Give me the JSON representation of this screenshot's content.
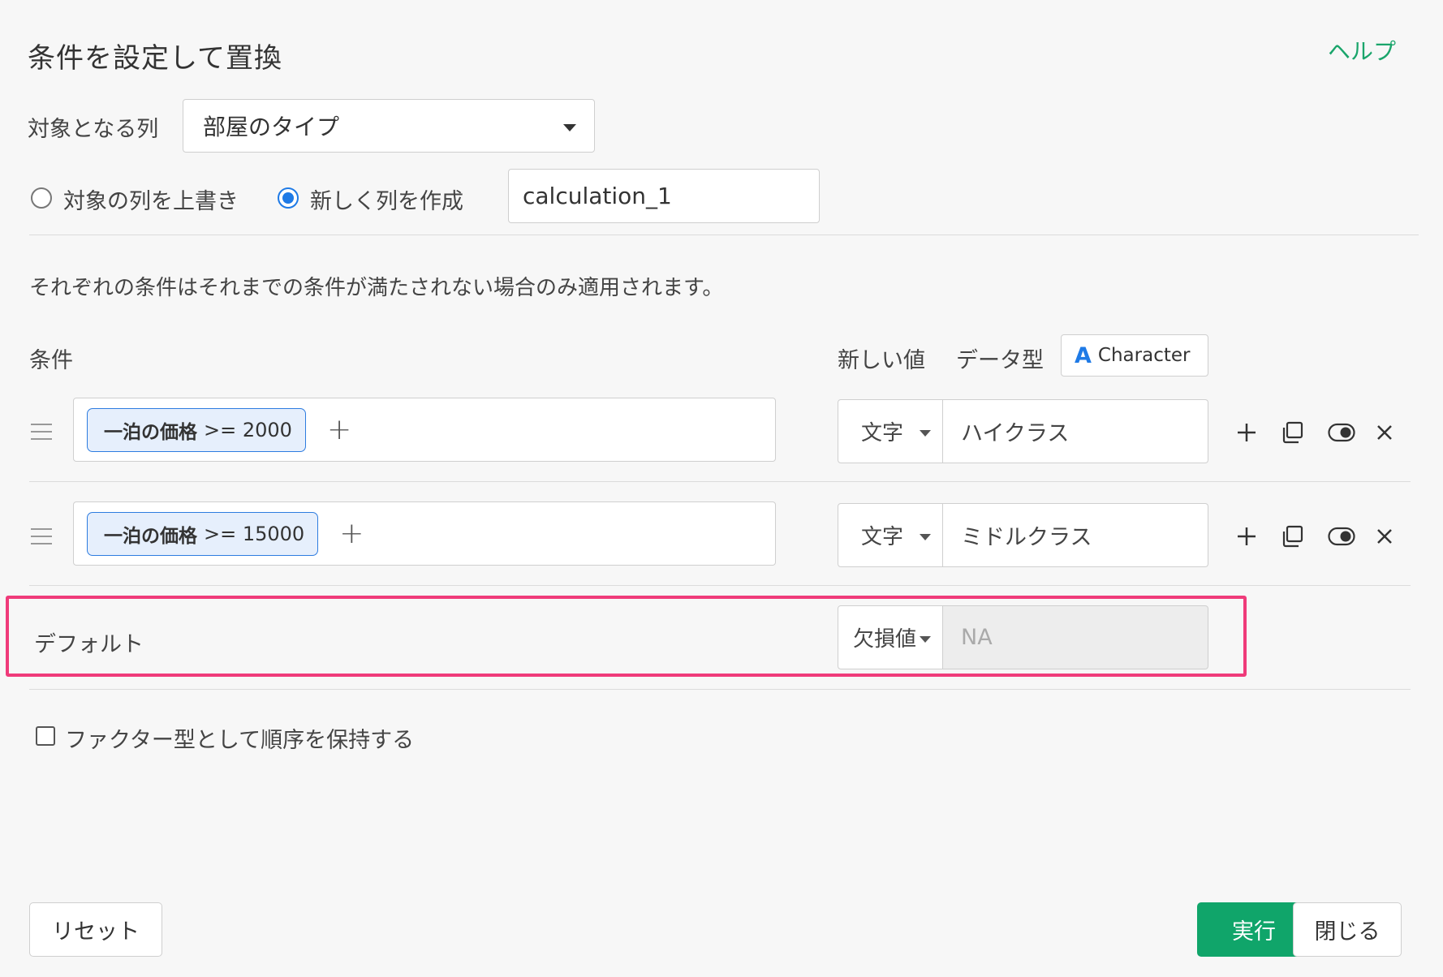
{
  "dialog": {
    "title": "条件を設定して置換",
    "help": "ヘルプ"
  },
  "target_column": {
    "label": "対象となる列",
    "selected": "部屋のタイプ"
  },
  "mode": {
    "overwrite_label": "対象の列を上書き",
    "new_column_label": "新しく列を作成",
    "selected": "new_column",
    "new_column_name": "calculation_1"
  },
  "note": "それぞれの条件はそれまでの条件が満たされない場合のみ適用されます。",
  "headers": {
    "condition": "条件",
    "new_value": "新しい値",
    "data_type": "データ型",
    "data_type_value": "Character",
    "data_type_icon": "A"
  },
  "conditions": [
    {
      "column": "一泊の価格",
      "operator_value": ">= 2000",
      "value_type": "文字",
      "value": "ハイクラス"
    },
    {
      "column": "一泊の価格",
      "operator_value": ">= 15000",
      "value_type": "文字",
      "value": "ミドルクラス"
    }
  ],
  "default_row": {
    "label": "デフォルト",
    "value_type": "欠損値",
    "value": "NA",
    "highlight_color": "#ef3b7a"
  },
  "factor_option": {
    "label": "ファクター型として順序を保持する",
    "checked": false
  },
  "buttons": {
    "reset": "リセット",
    "run": "実行",
    "close": "閉じる"
  },
  "colors": {
    "accent_green": "#10a56a",
    "link_green": "#1aa56b",
    "accent_blue": "#1e7ae6",
    "chip_bg": "#e6effc"
  }
}
